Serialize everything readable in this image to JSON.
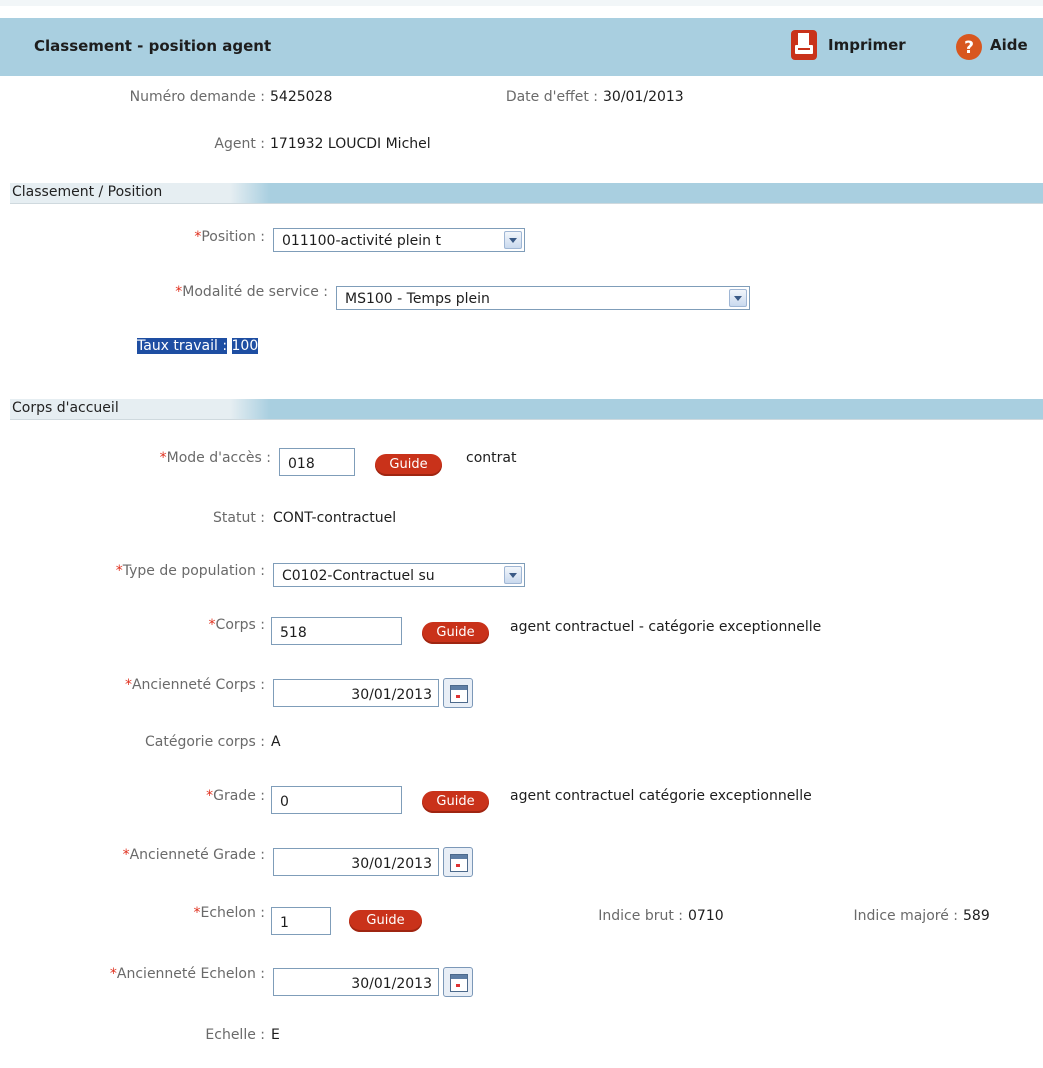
{
  "header": {
    "title": "Classement - position agent",
    "print_label": "Imprimer",
    "help_label": "Aide"
  },
  "info": {
    "numero_label": "Numéro demande :",
    "numero_value": "5425028",
    "date_effet_label": "Date d'effet :",
    "date_effet_value": "30/01/2013",
    "agent_label": "Agent :",
    "agent_value": "171932 LOUCDI Michel"
  },
  "section_classement": {
    "title": "Classement / Position",
    "position_label": "Position :",
    "position_value": "011100-activité plein t",
    "modalite_label": "Modalité de service :",
    "modalite_value": "MS100 - Temps plein",
    "taux_label": "Taux travail :",
    "taux_value": "100"
  },
  "section_corps": {
    "title": "Corps d'accueil",
    "mode_acces_label": "Mode d'accès :",
    "mode_acces_value": "018",
    "mode_acces_desc": "contrat",
    "statut_label": "Statut :",
    "statut_value": "CONT-contractuel",
    "type_population_label": "Type de population :",
    "type_population_value": "C0102-Contractuel su",
    "corps_label": "Corps :",
    "corps_value": "518",
    "corps_desc": "agent contractuel - catégorie exceptionnelle",
    "anc_corps_label": "Ancienneté Corps :",
    "anc_corps_value": "30/01/2013",
    "categorie_label": "Catégorie corps :",
    "categorie_value": "A",
    "grade_label": "Grade :",
    "grade_value": "0",
    "grade_desc": "agent contractuel catégorie exceptionnelle",
    "anc_grade_label": "Ancienneté Grade :",
    "anc_grade_value": "30/01/2013",
    "echelon_label": "Echelon :",
    "echelon_value": "1",
    "indice_brut_label": "Indice brut :",
    "indice_brut_value": "0710",
    "indice_majore_label": "Indice majoré :",
    "indice_majore_value": "589",
    "anc_echelon_label": "Ancienneté Echelon :",
    "anc_echelon_value": "30/01/2013",
    "echelle_label": "Echelle :",
    "echelle_value": "E"
  },
  "buttons": {
    "guide_label": "Guide"
  },
  "required_marker": "*"
}
